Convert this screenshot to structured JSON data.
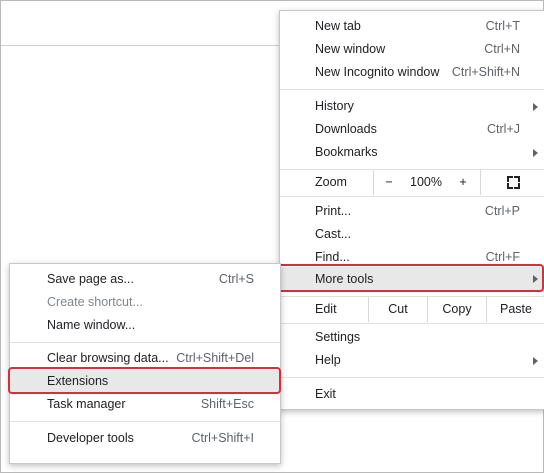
{
  "main_menu": {
    "new_tab": {
      "label": "New tab",
      "shortcut": "Ctrl+T"
    },
    "new_window": {
      "label": "New window",
      "shortcut": "Ctrl+N"
    },
    "new_incognito": {
      "label": "New Incognito window",
      "shortcut": "Ctrl+Shift+N"
    },
    "history": {
      "label": "History"
    },
    "downloads": {
      "label": "Downloads",
      "shortcut": "Ctrl+J"
    },
    "bookmarks": {
      "label": "Bookmarks"
    },
    "zoom": {
      "label": "Zoom",
      "minus": "−",
      "value": "100%",
      "plus": "+"
    },
    "print": {
      "label": "Print...",
      "shortcut": "Ctrl+P"
    },
    "cast": {
      "label": "Cast..."
    },
    "find": {
      "label": "Find...",
      "shortcut": "Ctrl+F"
    },
    "more_tools": {
      "label": "More tools"
    },
    "edit": {
      "label": "Edit",
      "cut": "Cut",
      "copy": "Copy",
      "paste": "Paste"
    },
    "settings": {
      "label": "Settings"
    },
    "help": {
      "label": "Help"
    },
    "exit": {
      "label": "Exit"
    }
  },
  "sub_menu": {
    "save_page": {
      "label": "Save page as...",
      "shortcut": "Ctrl+S"
    },
    "create_shortcut": {
      "label": "Create shortcut..."
    },
    "name_window": {
      "label": "Name window..."
    },
    "clear_browsing": {
      "label": "Clear browsing data...",
      "shortcut": "Ctrl+Shift+Del"
    },
    "extensions": {
      "label": "Extensions"
    },
    "task_manager": {
      "label": "Task manager",
      "shortcut": "Shift+Esc"
    },
    "developer_tools": {
      "label": "Developer tools",
      "shortcut": "Ctrl+Shift+I"
    }
  },
  "colors": {
    "highlight_outline": "#d32f3c",
    "hover_bg": "#e8e8e8"
  }
}
